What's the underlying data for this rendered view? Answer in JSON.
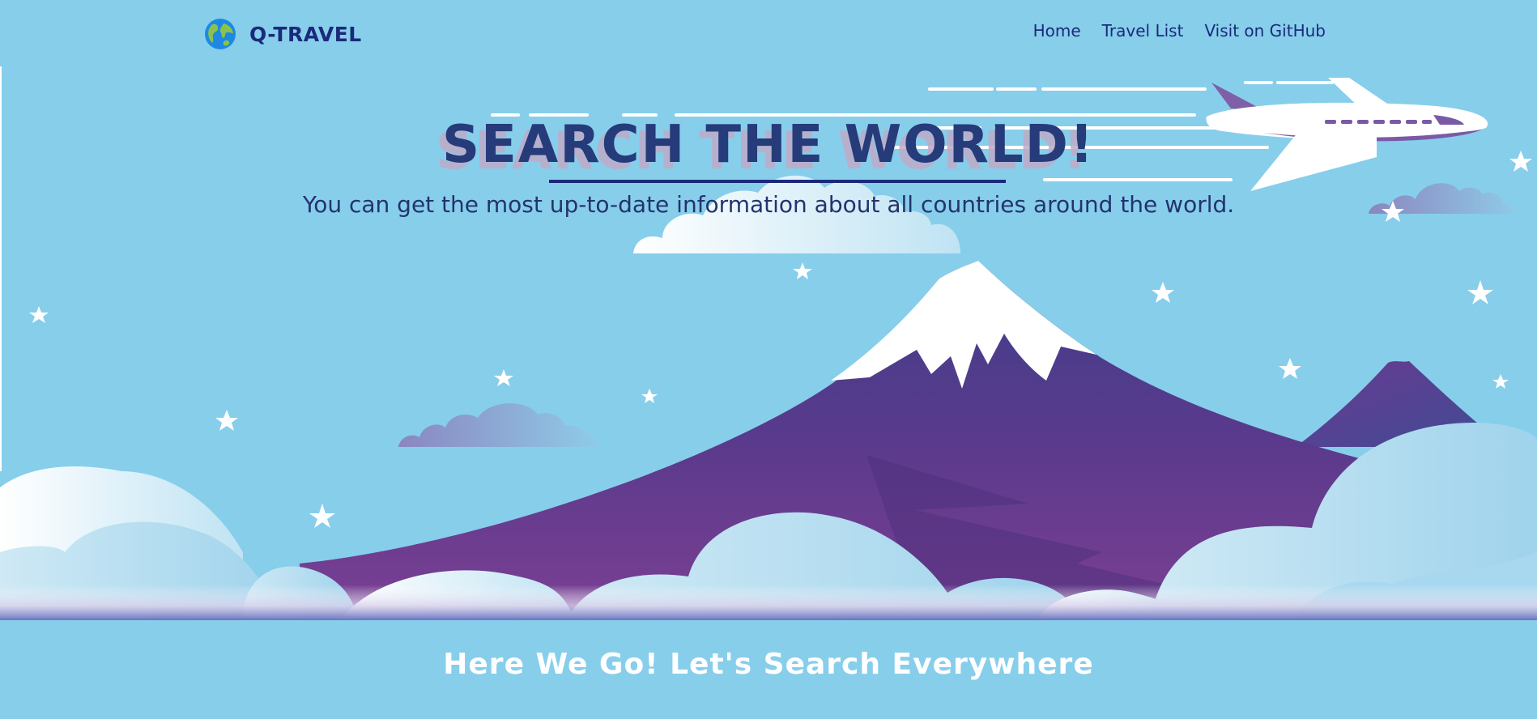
{
  "brand": {
    "name": "Q-TRAVEL",
    "icon": "globe-icon"
  },
  "nav": {
    "links": [
      "Home",
      "Travel List",
      "Visit on GitHub"
    ]
  },
  "hero": {
    "title": "SEARCH THE WORLD!",
    "subtitle": "You can get the most up-to-date information about all countries around the world.",
    "illustration": [
      "airplane-icon",
      "mountain",
      "clouds",
      "stars"
    ]
  },
  "cta": {
    "text": "Here We Go! Let's Search Everywhere"
  },
  "colors": {
    "background": "#87ceeb",
    "brand_text": "#1b2a7a",
    "title_text": "#263b7a",
    "mountain": "#5b3a8a",
    "cta_text": "#ffffff"
  }
}
